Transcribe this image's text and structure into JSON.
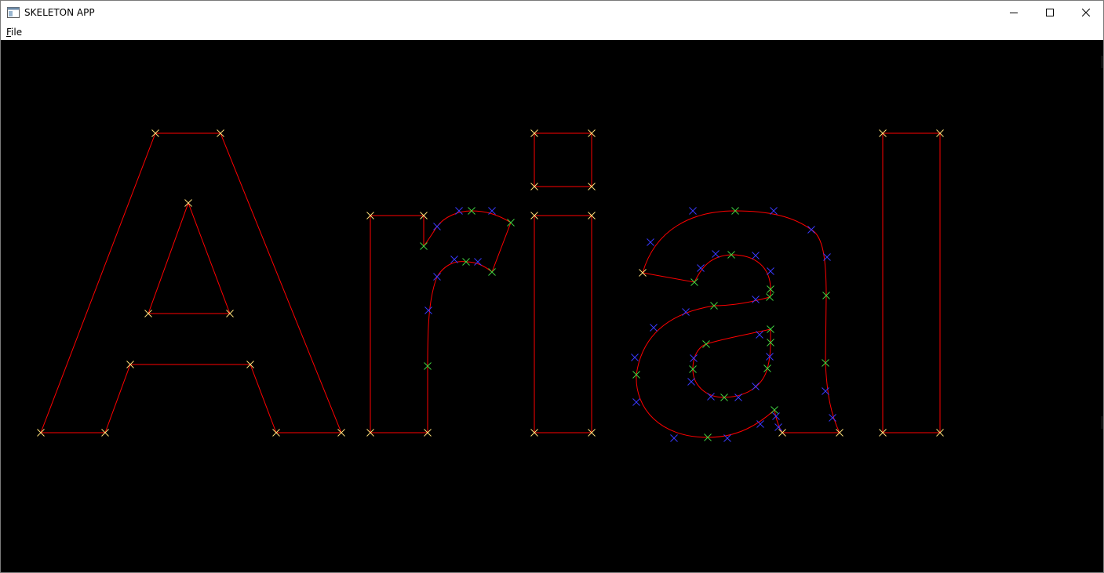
{
  "window": {
    "title": "SKELETON APP",
    "icon": "app-window-icon"
  },
  "controls": {
    "minimize_icon": "minimize-icon",
    "maximize_icon": "maximize-icon",
    "close_icon": "close-icon"
  },
  "menu": {
    "file_mnemonic": "F",
    "file_rest": "ile"
  },
  "canvas": {
    "background": "#000000",
    "outline_color": "#ff0000",
    "on_curve_color": "#ffe07a",
    "control_on_color": "#3fd23f",
    "control_off_color": "#3a3aff"
  }
}
